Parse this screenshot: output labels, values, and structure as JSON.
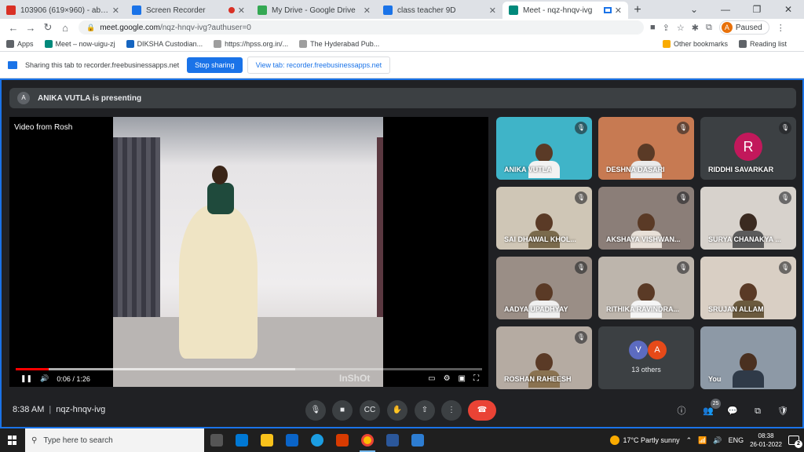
{
  "browser": {
    "tabs": [
      {
        "title": "103906 (619×960) - abdul.rahim@...",
        "color": "#d93025"
      },
      {
        "title": "Screen Recorder",
        "color": "#1a73e8"
      },
      {
        "title": "My Drive - Google Drive",
        "color": "#34a853"
      },
      {
        "title": "class teacher 9D",
        "color": "#1a73e8"
      },
      {
        "title": "Meet - nqz-hnqv-ivg",
        "color": "#00897b"
      }
    ],
    "new_tab": "+",
    "url_host": "meet.google.com",
    "url_path": "/nqz-hnqv-ivg?authuser=0",
    "profile_letter": "A",
    "paused_label": "Paused",
    "bookmarks": [
      {
        "label": "Apps",
        "color": "#5f6368"
      },
      {
        "label": "Meet – now-uigu-zj",
        "color": "#00897b"
      },
      {
        "label": "DIKSHA Custodian...",
        "color": "#1565c0"
      },
      {
        "label": "https://hpss.org.in/...",
        "color": "#9e9e9e"
      },
      {
        "label": "The Hyderabad Pub...",
        "color": "#9e9e9e"
      }
    ],
    "other_bookmarks": "Other bookmarks",
    "reading_list": "Reading list"
  },
  "share_bar": {
    "text": "Sharing this tab to recorder.freebusinessapps.net",
    "stop_label": "Stop sharing",
    "view_label": "View tab: recorder.freebusinessapps.net"
  },
  "meet": {
    "presenter_initial": "A",
    "presenter_text": "ANIKA VUTLA is presenting",
    "video_label": "Video from Rosh",
    "playback": {
      "current": "0:06",
      "total": "1:26",
      "time_text": "0:06 / 1:26",
      "played_fraction": 0.07,
      "buffered_fraction": 0.6
    },
    "watermark": "InShOt",
    "participants": [
      {
        "name": "ANIKA VUTLA",
        "bg": "#3fb4c8"
      },
      {
        "name": "DESHNA DASARI",
        "bg": "#c77a52"
      },
      {
        "name": "RIDDHI SAVARKAR",
        "bg": "#3c4043",
        "initial": "R"
      },
      {
        "name": "SAI DHAWAL KHOL...",
        "bg": "#cfc6b6"
      },
      {
        "name": "AKSHAYA VISHWAN...",
        "bg": "#8b7e78"
      },
      {
        "name": "SURYA CHANAKYA ...",
        "bg": "#d7d2cc"
      },
      {
        "name": "AADYA UPADHYAY",
        "bg": "#9a8e86"
      },
      {
        "name": "RITHIKA RAVINDRA...",
        "bg": "#bdb5ac"
      },
      {
        "name": "SRUJAN ALLAM",
        "bg": "#d9cfc4"
      },
      {
        "name": "ROSHAN RAHEESH",
        "bg": "#b5aba2"
      },
      {
        "name": "13 others",
        "bg": "#3c4043",
        "avatars": [
          "V",
          "A"
        ]
      },
      {
        "name": "You",
        "bg": "#8d99a6"
      }
    ],
    "time": "8:38 AM",
    "meeting_code": "nqz-hnqv-ivg",
    "people_count": "25"
  },
  "taskbar": {
    "search_placeholder": "Type here to search",
    "weather": "17°C  Partly sunny",
    "language": "ENG",
    "clock_time": "08:38",
    "clock_date": "26-01-2022",
    "notifications": "2"
  }
}
